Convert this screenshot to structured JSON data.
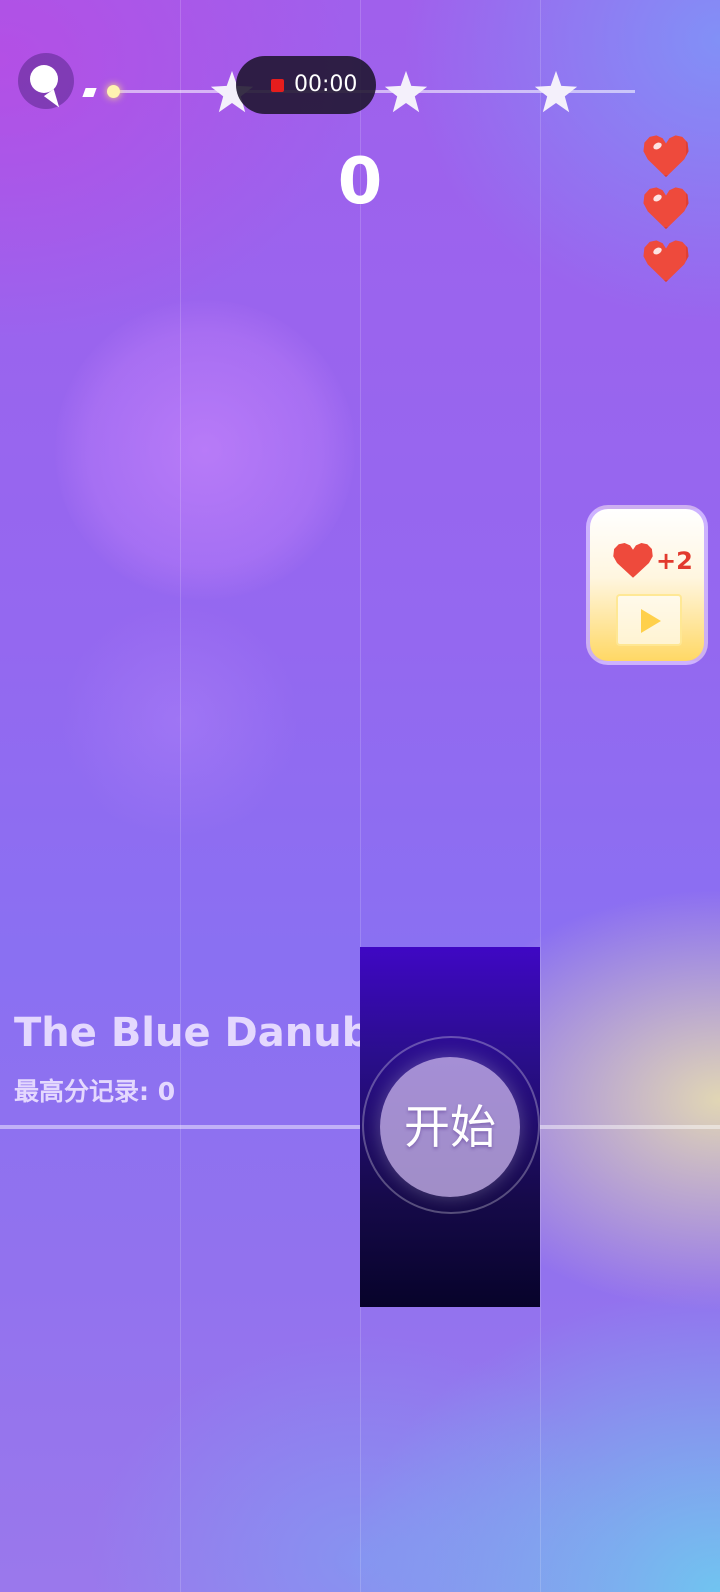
{
  "hud": {
    "timer": "00:00",
    "score": "0",
    "lives": 3,
    "progress": 0
  },
  "bonus": {
    "label": "+2"
  },
  "song": {
    "title": "The Blue Danube",
    "best_score": "最高分记录: 0"
  },
  "start": {
    "label": "开始"
  },
  "colors": {
    "heart": "#ee4a3c",
    "tile": "#2a0e8c",
    "record": "#e51d1d"
  }
}
